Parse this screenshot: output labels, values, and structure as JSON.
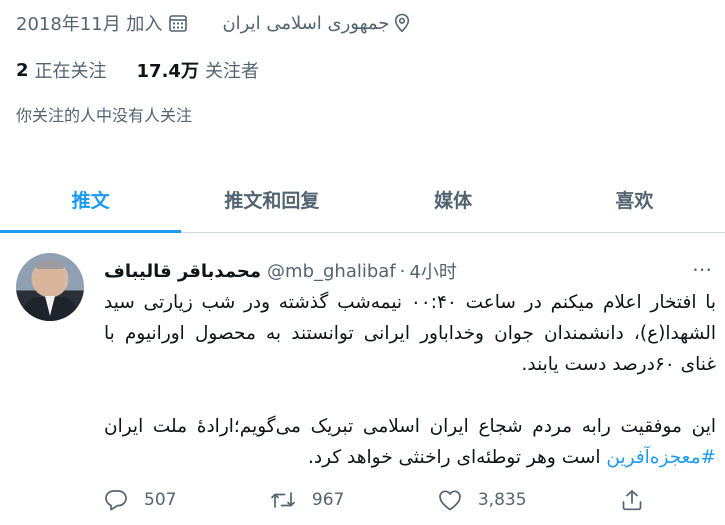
{
  "profile": {
    "joined": "2018年11月 加入",
    "location": "جمهوری اسلامی ایران",
    "following_count": "2",
    "following_label": "正在关注",
    "followers_count": "17.4万",
    "followers_label": "关注者",
    "followed_by": "你关注的人中没有人关注"
  },
  "tabs": [
    {
      "label": "推文",
      "active": true
    },
    {
      "label": "推文和回复",
      "active": false
    },
    {
      "label": "媒体",
      "active": false
    },
    {
      "label": "喜欢",
      "active": false
    }
  ],
  "tweet": {
    "author_name": "محمدباقر قالیباف",
    "handle": "@mb_ghalibaf",
    "separator": "·",
    "time": "4小时",
    "more_icon": "⋯",
    "paragraph1": "با افتخار اعلام میکنم در ساعت ۰۰:۴۰ نیمه‌شب گذشته ودر شب زیارتی سید الشهدا(ع)، دانشمندان جوان وخداباور ایرانی توانستند به محصول اورانیوم با غنای ۶۰درصد دست یابند.",
    "paragraph2_before": "این موفقیت رابه مردم شجاع ایران اسلامی تبریک می‌گویم؛ارادهٔ ملت ایران ",
    "hashtag": "#معجزه‌آفرین",
    "paragraph2_after": " است وهر توطئه‌ای راخنثی خواهد کرد.",
    "replies": "507",
    "retweets": "967",
    "likes": "3,835"
  },
  "colors": {
    "accent": "#1d9bf0",
    "text": "#0f1419",
    "secondary": "#536471",
    "border": "#cfd9de"
  },
  "icons": [
    "calendar-icon",
    "location-pin-icon",
    "more-icon",
    "reply-icon",
    "retweet-icon",
    "like-icon",
    "share-icon"
  ]
}
